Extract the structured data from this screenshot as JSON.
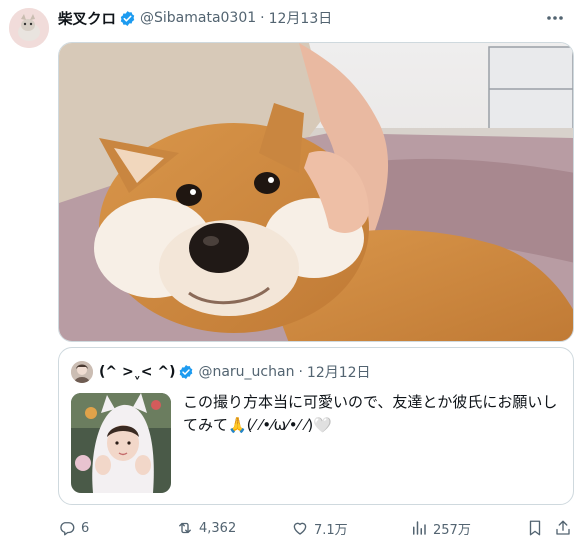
{
  "tweet": {
    "display_name": "柴叉クロ",
    "handle": "@Sibamata0301",
    "separator": "·",
    "date": "12月13日"
  },
  "quote": {
    "display_name": "(^ >ˬ< ^)",
    "handle": "@naru_uchan",
    "separator": "·",
    "date": "12月12日",
    "text": "この撮り方本当に可愛いので、友達とか彼氏にお願いしてみて🙏(⁄ ⁄•⁄ω⁄•⁄ ⁄)🤍"
  },
  "actions": {
    "replies": "6",
    "reposts": "4,362",
    "likes": "7.1万",
    "views": "257万"
  },
  "colors": {
    "verified_blue": "#1d9bf0",
    "secondary_text": "#536471",
    "border": "#cfd9de"
  },
  "icons": [
    "more-icon",
    "verified-badge-icon",
    "reply-icon",
    "repost-icon",
    "like-icon",
    "views-icon",
    "bookmark-icon",
    "share-icon"
  ]
}
